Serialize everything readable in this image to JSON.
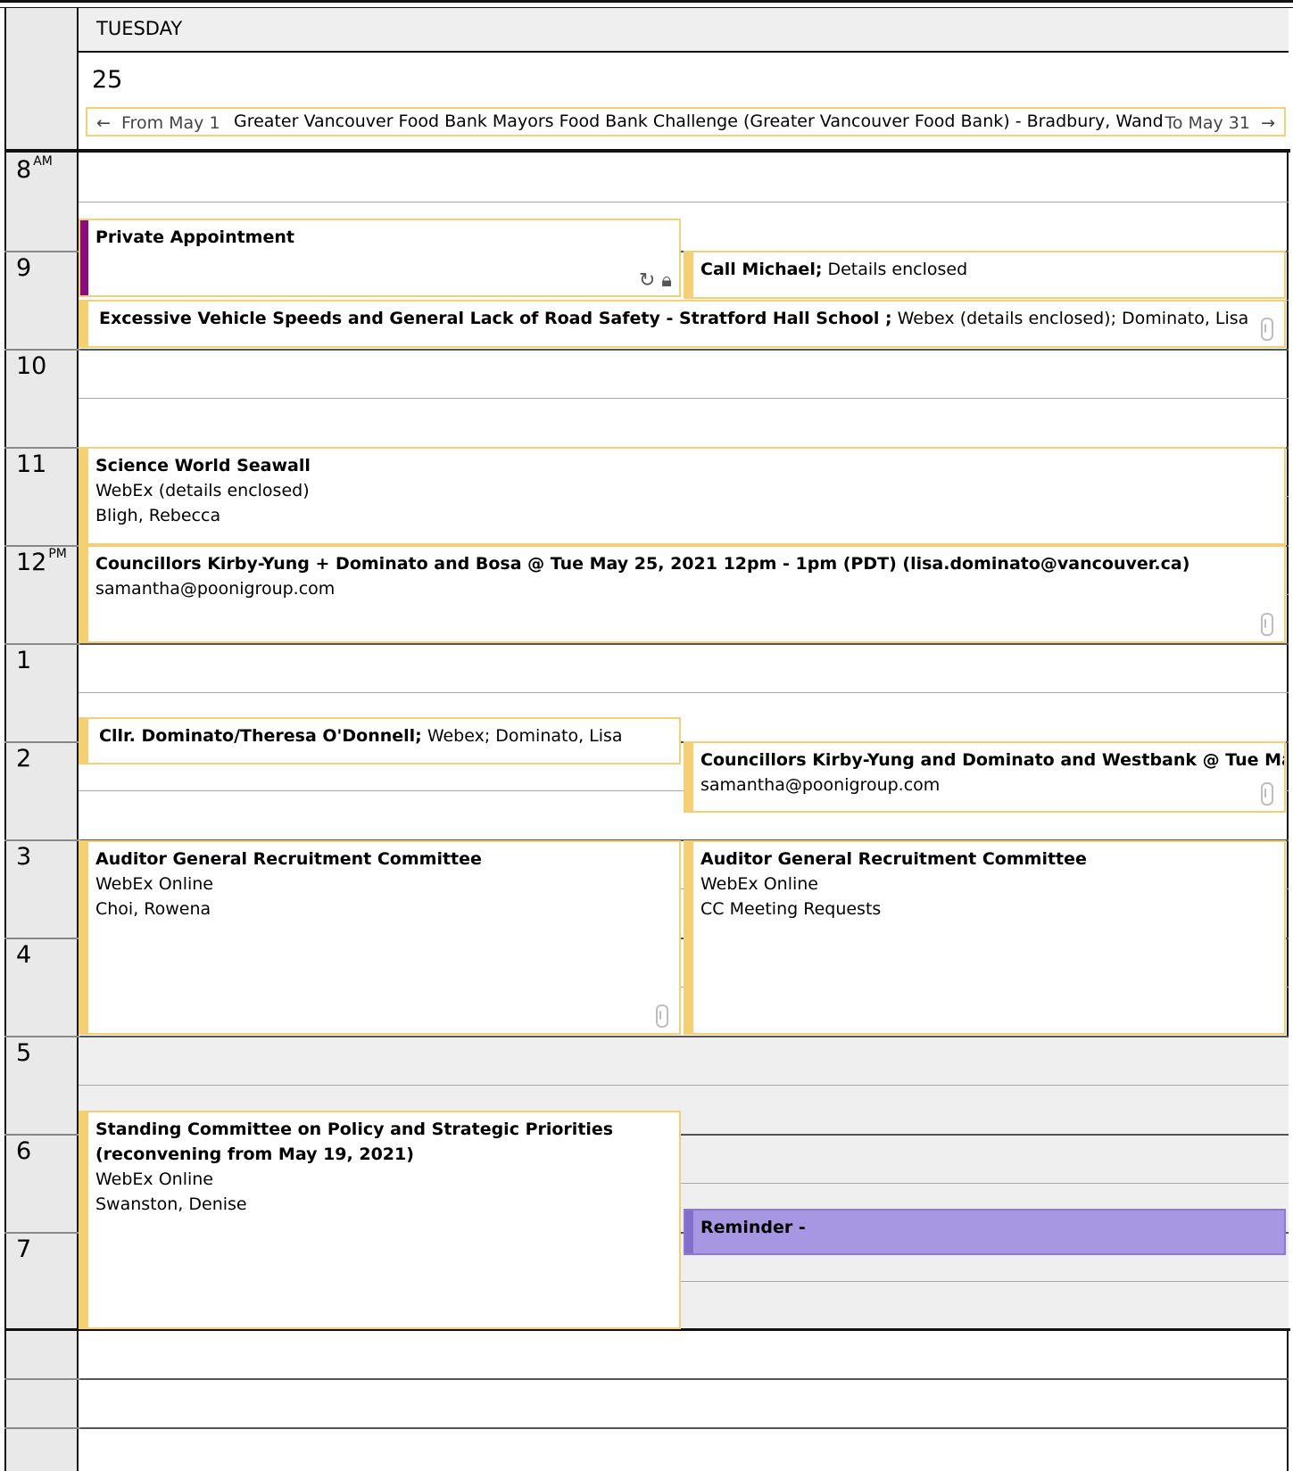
{
  "header": {
    "day_name": "TUESDAY",
    "date_number": "25"
  },
  "all_day_event": {
    "from_label": "From May 1",
    "title": "Greater Vancouver Food Bank Mayors Food Bank Challenge (Greater Vancouver Food Bank) - Bradbury, Wanda",
    "to_label": "To May 31"
  },
  "hours": [
    {
      "label": "8",
      "suffix": "AM"
    },
    {
      "label": "9",
      "suffix": ""
    },
    {
      "label": "10",
      "suffix": ""
    },
    {
      "label": "11",
      "suffix": ""
    },
    {
      "label": "12",
      "suffix": "PM"
    },
    {
      "label": "1",
      "suffix": ""
    },
    {
      "label": "2",
      "suffix": ""
    },
    {
      "label": "3",
      "suffix": ""
    },
    {
      "label": "4",
      "suffix": ""
    },
    {
      "label": "5",
      "suffix": ""
    },
    {
      "label": "6",
      "suffix": ""
    },
    {
      "label": "7",
      "suffix": ""
    }
  ],
  "appointments": {
    "private": {
      "title": "Private Appointment",
      "icons": [
        "recurring-icon",
        "lock-icon"
      ],
      "category_color": "#8b0a7e"
    },
    "call_michael": {
      "title": "Call Michael;",
      "detail": "Details enclosed"
    },
    "vehicle_speeds": {
      "title": "Excessive Vehicle Speeds and General Lack of Road Safety - Stratford Hall School ;",
      "detail": "Webex (details enclosed); Dominato, Lisa"
    },
    "science_world": {
      "title": "Science World Seawall",
      "location": "WebEx (details enclosed)",
      "organizer": "Bligh, Rebecca"
    },
    "councillors_bosa": {
      "title": "Councillors Kirby-Yung + Dominato and Bosa  @ Tue May 25, 2021 12pm - 1pm (PDT) (lisa.dominato@vancouver.ca)",
      "organizer": "samantha@poonigroup.com"
    },
    "cllr_dominato": {
      "title": "Cllr. Dominato/Theresa O'Donnell;",
      "detail": "Webex; Dominato, Lisa"
    },
    "councillors_westbank": {
      "title": "Councillors Kirby-Yung and Dominato and Westbank @ Tue May",
      "organizer": "samantha@poonigroup.com"
    },
    "auditor_1": {
      "title": "Auditor General Recruitment Committee",
      "location": "WebEx Online",
      "organizer": "Choi, Rowena"
    },
    "auditor_2": {
      "title": "Auditor General Recruitment Committee",
      "location": "WebEx Online",
      "organizer": "CC Meeting Requests"
    },
    "standing_committee": {
      "title_line1": "Standing Committee on Policy and Strategic Priorities",
      "title_line2": "(reconvening from May 19, 2021)",
      "location": "WebEx Online",
      "organizer": "Swanston, Denise"
    },
    "reminder": {
      "title": "Reminder -"
    }
  },
  "colors": {
    "appointment_border": "#f5cf73",
    "reminder_fill": "#a797e2",
    "private_category": "#8b0a7e"
  }
}
